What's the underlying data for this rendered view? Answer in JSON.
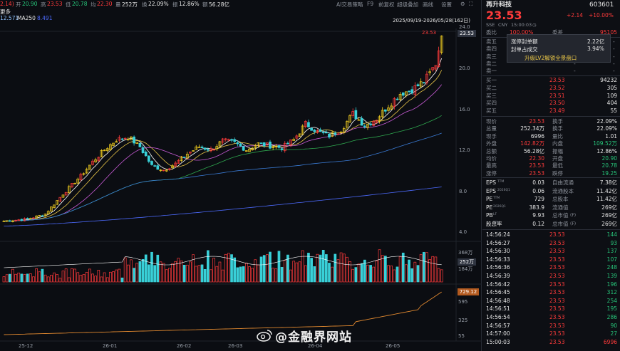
{
  "header": {
    "chg_partial": "2.14)",
    "open_label": "开",
    "open": "20.90",
    "high_label": "高",
    "high": "23.53",
    "low_label": "低",
    "low": "20.78",
    "avg_label": "均",
    "avg": "22.30",
    "vol_label": "量",
    "vol": "252万",
    "turn_label": "换",
    "turn": "22.09%",
    "amp_label": "振",
    "amp": "12.86%",
    "amt_label": "额",
    "amt": "56.28亿",
    "menus": [
      "AI交易策略",
      "F9",
      "前复权",
      "超级叠加",
      "画线",
      "设置"
    ],
    "more": "更多",
    "ma_partial": "12.571",
    "ma250_label": "MA250",
    "ma250": "8.491",
    "date_range": "2025/09/19-2026/05/28(162日)"
  },
  "price_axis": [
    "24.0",
    "20.0",
    "16.0",
    "12.0",
    "8.0",
    "4.0"
  ],
  "price_tag": "23.53",
  "high_label": "23.53",
  "vol_axis": [
    "368万",
    "184万"
  ],
  "vol_tag": "252万",
  "ind_axis": [
    "595",
    "325",
    "55"
  ],
  "ind_tag": "729.12",
  "date_axis": [
    "25-12",
    "26-01",
    "26-02",
    "26-03",
    "26-04",
    "26-05"
  ],
  "quote": {
    "name": "再升科技",
    "code": "603601",
    "price": "23.53",
    "chg": "+2.14",
    "pct": "+10.00%",
    "exchange": "SSE",
    "currency": "CNY",
    "time": "15:00:03",
    "ratio_label": "委比",
    "ratio": "100.00%",
    "diff_label": "委差",
    "diff": "95105",
    "sell_labels": [
      "卖五",
      "卖四",
      "卖三",
      "卖二",
      "卖一"
    ],
    "buy": [
      {
        "label": "买一",
        "price": "23.53",
        "vol": "94232"
      },
      {
        "label": "买二",
        "price": "23.52",
        "vol": "305"
      },
      {
        "label": "买三",
        "price": "23.51",
        "vol": "109"
      },
      {
        "label": "买四",
        "price": "23.50",
        "vol": "404"
      },
      {
        "label": "买五",
        "price": "23.49",
        "vol": "55"
      }
    ],
    "dash": "-",
    "stats": [
      {
        "l1": "现价",
        "v1": "23.53",
        "c1": "up",
        "l2": "换手",
        "v2": "22.09%",
        "c2": "wh"
      },
      {
        "l1": "总量",
        "v1": "252.34万",
        "c1": "wh",
        "l2": "换手",
        "v2": "22.09%",
        "c2": "wh"
      },
      {
        "l1": "现手",
        "v1": "6996",
        "c1": "wh",
        "l2": "量比",
        "v2": "1.01",
        "c2": "wh"
      },
      {
        "l1": "外盘",
        "v1": "142.82万",
        "c1": "up",
        "l2": "内盘",
        "v2": "109.52万",
        "c2": "dn"
      },
      {
        "l1": "总额",
        "v1": "56.28亿",
        "c1": "wh",
        "l2": "振幅",
        "v2": "12.86%",
        "c2": "wh"
      },
      {
        "l1": "均价",
        "v1": "22.30",
        "c1": "up",
        "l2": "开盘",
        "v2": "20.90",
        "c2": "dn"
      },
      {
        "l1": "最高",
        "v1": "23.53",
        "c1": "up",
        "l2": "最低",
        "v2": "20.78",
        "c2": "dn"
      },
      {
        "l1": "涨停",
        "v1": "23.53",
        "c1": "up",
        "l2": "跌停",
        "v2": "19.25",
        "c2": "dn"
      }
    ],
    "fin": [
      {
        "l1": "EPS",
        "s1": "TTM",
        "v1": "0.03",
        "l2": "自由流通",
        "v2": "7.38亿"
      },
      {
        "l1": "EPS",
        "s1": "2026Q1",
        "v1": "0.06",
        "l2": "流通股本",
        "v2": "11.42亿"
      },
      {
        "l1": "PE",
        "s1": "TTM",
        "v1": "729",
        "l2": "总股本",
        "v2": "11.42亿"
      },
      {
        "l1": "PE",
        "s1": "2026Q1",
        "v1": "383.9",
        "l2": "流通值",
        "v2": "269亿"
      },
      {
        "l1": "PB",
        "s1": "LF",
        "v1": "9.93",
        "l2": "总市值",
        "s2": "(F)",
        "v2": "269亿"
      },
      {
        "l1": "股息率",
        "s1": "TTM",
        "v1": "0.12",
        "l2": "总市值",
        "s2": "(F)",
        "v2": "269亿"
      }
    ],
    "ticks": [
      {
        "t": "14:56:24",
        "p": "23.53",
        "v": "144"
      },
      {
        "t": "14:56:27",
        "p": "23.53",
        "v": "93"
      },
      {
        "t": "14:56:30",
        "p": "23.53",
        "v": "137"
      },
      {
        "t": "14:56:33",
        "p": "23.53",
        "v": "107"
      },
      {
        "t": "14:56:36",
        "p": "23.53",
        "v": "248"
      },
      {
        "t": "14:56:39",
        "p": "23.53",
        "v": "139"
      },
      {
        "t": "14:56:42",
        "p": "23.53",
        "v": "196"
      },
      {
        "t": "14:56:45",
        "p": "23.53",
        "v": "312"
      },
      {
        "t": "14:56:48",
        "p": "23.53",
        "v": "254"
      },
      {
        "t": "14:56:51",
        "p": "23.53",
        "v": "195"
      },
      {
        "t": "14:56:54",
        "p": "23.53",
        "v": "286"
      },
      {
        "t": "14:56:57",
        "p": "23.53",
        "v": "90"
      },
      {
        "t": "14:57:00",
        "p": "23.53",
        "v": "27"
      },
      {
        "t": "15:00:03",
        "p": "23.53",
        "v": "6996"
      }
    ]
  },
  "popup": {
    "row1_label": "涨停封单额",
    "row1_value": "2.22亿",
    "row2_label": "封单占成交",
    "row2_value": "3.94%",
    "cta": "升级LV2解锁全景盘口"
  },
  "watermark": "@金融界网站",
  "colors": {
    "up": "#ff3b3b",
    "down": "#27c57a",
    "bg": "#0b0d12",
    "accent": "#e8c547"
  }
}
